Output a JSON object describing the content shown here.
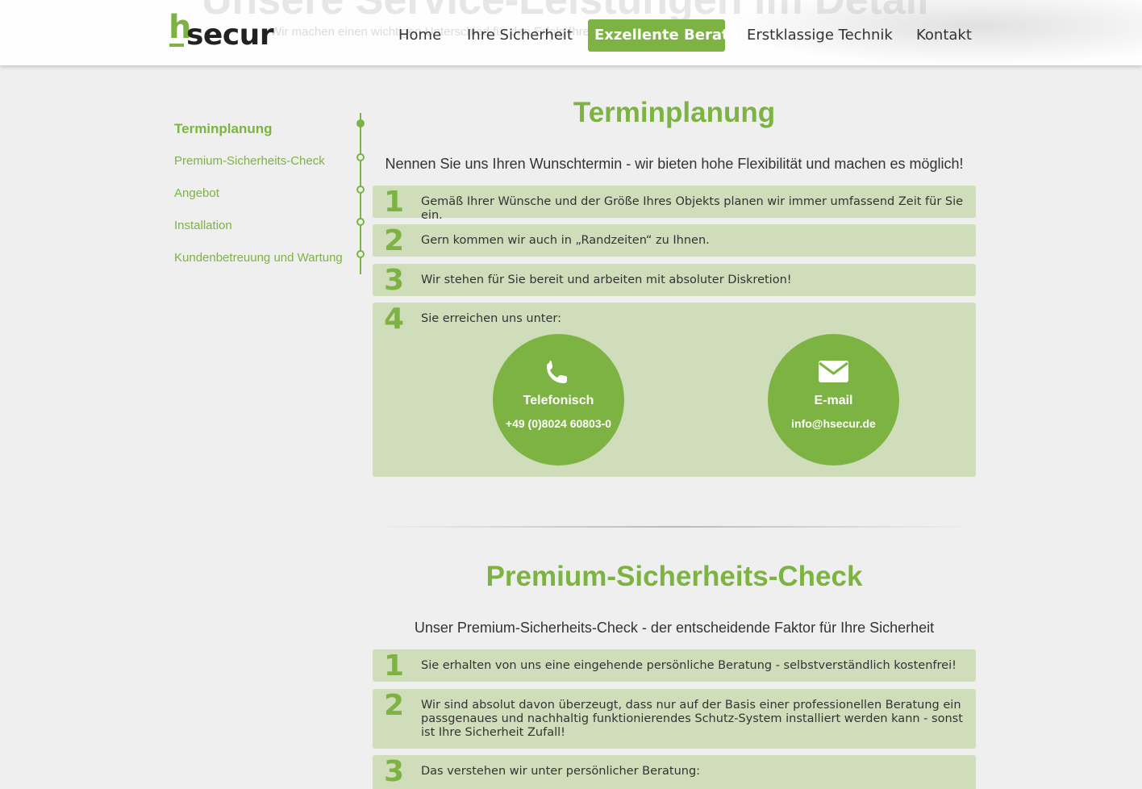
{
  "header": {
    "ghost_title": "Unsere Service-Leistungen im Detail",
    "ghost_subtitle": "Wir machen einen wichtigen Unterschied für den Erfolg Ihrer Sicherheit",
    "logo_h": "h",
    "logo_rest": "secur",
    "nav": [
      {
        "label": "Home"
      },
      {
        "label": "Ihre Sicherheit"
      },
      {
        "label": "Exzellente Berater"
      },
      {
        "label": "Erstklassige Technik"
      },
      {
        "label": "Kontakt"
      }
    ]
  },
  "sidebar": {
    "items": [
      {
        "label": "Terminplanung"
      },
      {
        "label": "Premium-Sicherheits-Check"
      },
      {
        "label": "Angebot"
      },
      {
        "label": "Installation"
      },
      {
        "label": "Kundenbetreuung und Wartung"
      }
    ]
  },
  "section1": {
    "title": "Terminplanung",
    "lead": "Nennen Sie uns Ihren Wunschtermin - wir bieten hohe Flexibilität und machen es möglich!",
    "steps": [
      {
        "num": "1",
        "text": "Gemäß Ihrer Wünsche und der Größe Ihres Objekts planen wir immer umfassend Zeit für Sie ein."
      },
      {
        "num": "2",
        "text": "Gern kommen wir auch in „Randzeiten“ zu Ihnen."
      },
      {
        "num": "3",
        "text": "Wir stehen für Sie bereit und arbeiten mit absoluter Diskretion!"
      },
      {
        "num": "4",
        "text": "Sie erreichen uns unter:"
      }
    ],
    "contacts": [
      {
        "icon": "phone-icon",
        "label": "Telefonisch",
        "value": "+49 (0)8024 60803-0"
      },
      {
        "icon": "envelope-icon",
        "label": "E-mail",
        "value": "info@hsecur.de"
      }
    ]
  },
  "section2": {
    "title": "Premium-Sicherheits-Check",
    "lead": "Unser Premium-Sicherheits-Check - der entscheidende Faktor für Ihre Sicherheit",
    "steps": [
      {
        "num": "1",
        "text": "Sie erhalten von uns eine eingehende persönliche Beratung - selbstverständlich kostenfrei!"
      },
      {
        "num": "2",
        "text": "Wir sind absolut davon überzeugt, dass nur auf der Basis einer professionellen Beratung ein passgenaues und nachhaltig funktionierendes Schutz-System installiert werden kann - sonst ist Ihre Sicherheit Zufall!"
      },
      {
        "num": "3",
        "text": "Das verstehen wir unter persönlicher Beratung:"
      }
    ]
  },
  "colors": {
    "accent": "#7cb342",
    "box_bg": "#d0ddbb",
    "page_bg": "#efefef"
  }
}
